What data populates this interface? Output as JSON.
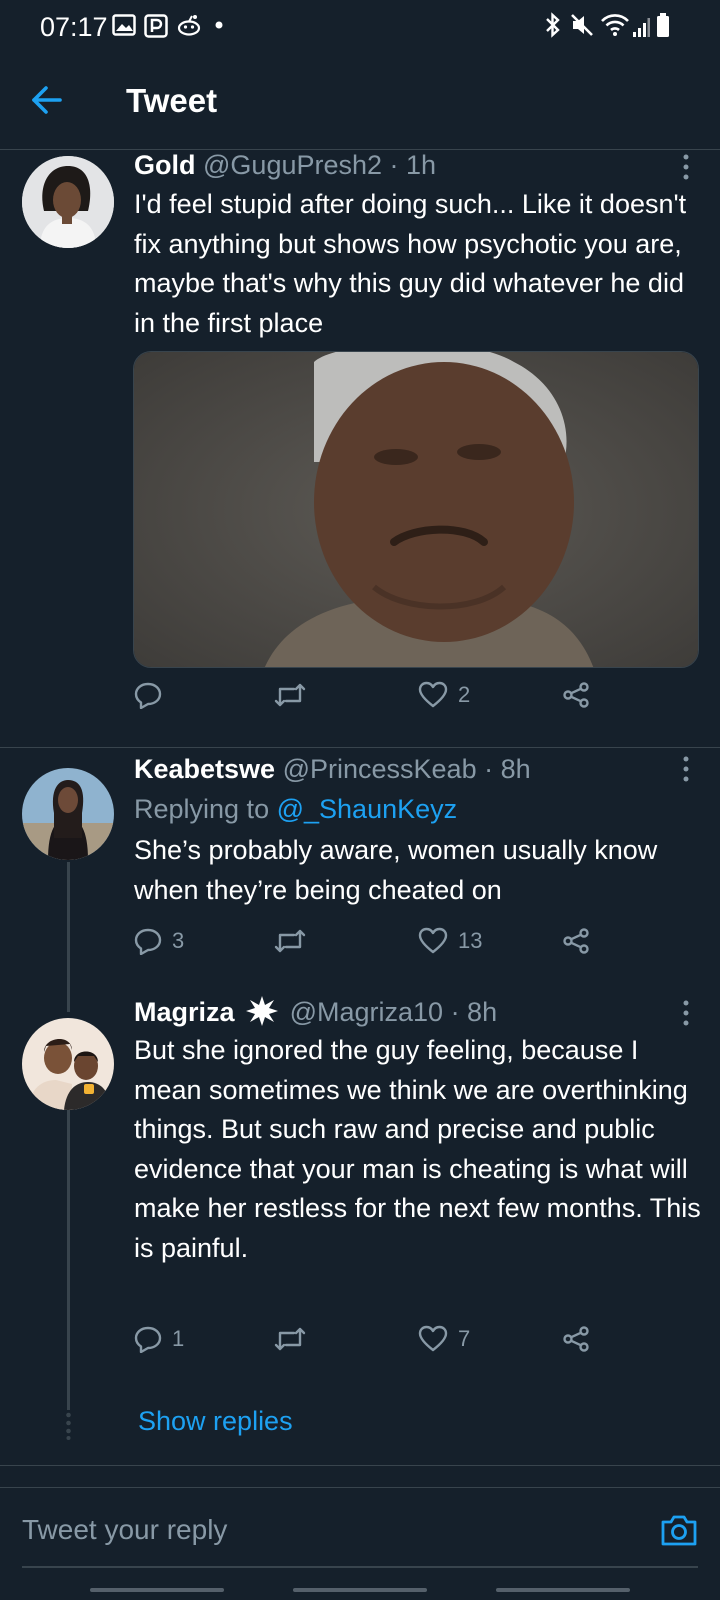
{
  "status_bar": {
    "time": "07:17",
    "left_icons": [
      "gallery-icon",
      "p-app-icon",
      "reddit-icon",
      "dot-icon"
    ],
    "right_icons": [
      "bluetooth-icon",
      "mute-icon",
      "wifi-icon",
      "signal-icon",
      "battery-icon"
    ]
  },
  "header": {
    "title": "Tweet",
    "back_icon": "arrow-left-icon"
  },
  "colors": {
    "background": "#15202b",
    "accent": "#1da1f2",
    "secondary_text": "#8899a6",
    "divider": "#38444d"
  },
  "tweets": [
    {
      "name": "Gold",
      "handle": "@GuguPresh2",
      "time": "· 1h",
      "text": "I'd feel stupid after doing such... Like it doesn't fix anything but shows how psychotic you are, maybe that's why this guy did whatever he did in the first place",
      "has_media": true,
      "reply_count": "",
      "retweet_count": "",
      "like_count": "2"
    },
    {
      "name": "Keabetswe",
      "handle": "@PrincessKeab",
      "time": "· 8h",
      "replying_prefix": "Replying to",
      "replying_to": "@_ShaunKeyz",
      "text": "She’s probably aware, women usually know when they’re being cheated on",
      "reply_count": "3",
      "retweet_count": "",
      "like_count": "13"
    },
    {
      "name": "Magriza",
      "name_badge": "starburst-emoji-icon",
      "handle": "@Magriza10",
      "time": "· 8h",
      "text": "But she ignored the guy feeling, because I mean sometimes we think we are overthinking things. But such raw and precise and public evidence that your man is cheating is what will make her restless for the next few months. This is painful.",
      "reply_count": "1",
      "retweet_count": "",
      "like_count": "7"
    }
  ],
  "show_replies": "Show replies",
  "reply_bar": {
    "placeholder": "Tweet your reply",
    "camera_icon": "camera-icon"
  }
}
